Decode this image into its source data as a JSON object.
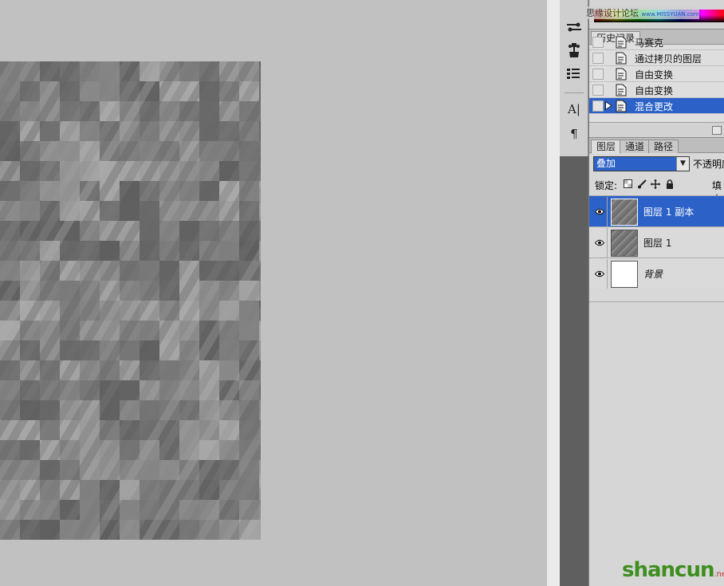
{
  "watermark": {
    "site_text": "思缘设计论坛",
    "site_url": "www.MISSYUAN.com"
  },
  "tools": [
    {
      "icon": "brush-presets-icon"
    },
    {
      "icon": "clone-source-icon"
    },
    {
      "icon": "tool-presets-icon"
    },
    {
      "icon": "character-icon",
      "glyph": "A|"
    },
    {
      "icon": "paragraph-icon",
      "glyph": "¶"
    }
  ],
  "history": {
    "tab_label": "历史记录",
    "items": [
      {
        "label": "马赛克",
        "selected": false
      },
      {
        "label": "通过拷贝的图层",
        "selected": false
      },
      {
        "label": "自由变换",
        "selected": false
      },
      {
        "label": "自由变换",
        "selected": false
      },
      {
        "label": "混合更改",
        "selected": true
      }
    ]
  },
  "layers_panel": {
    "tabs": [
      "图层",
      "通道",
      "路径"
    ],
    "active_tab": "图层",
    "blend_mode": "叠加",
    "opacity_label": "不透明度",
    "lock_label": "锁定:",
    "fill_label": "填充",
    "layers": [
      {
        "name": "图层 1 副本",
        "selected": true,
        "visible": true,
        "thumb": "noise"
      },
      {
        "name": "图层 1",
        "selected": false,
        "visible": true,
        "thumb": "noise"
      },
      {
        "name": "背景",
        "selected": false,
        "visible": true,
        "thumb": "white"
      }
    ]
  },
  "logo": {
    "text_main": "shancun",
    "text_sub": ".net"
  },
  "colors": {
    "selection": "#2c62c8",
    "canvas_bg": "#c1c1c1",
    "toolbar": "#5f5f5f"
  }
}
